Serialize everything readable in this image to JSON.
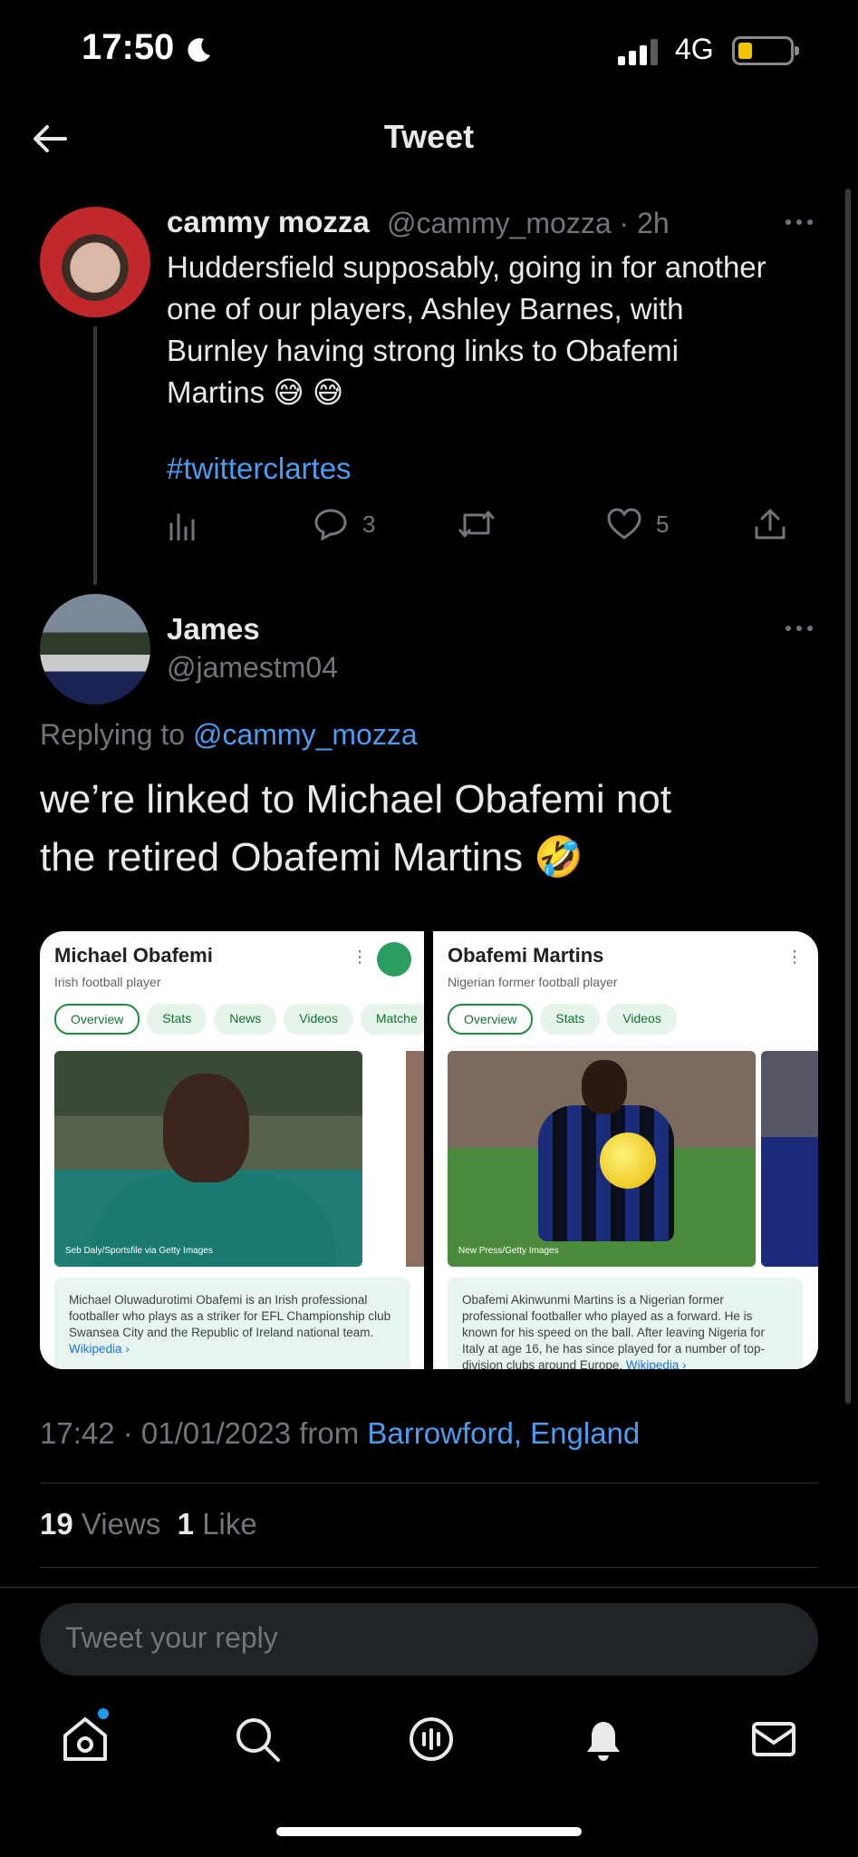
{
  "status_bar": {
    "time": "17:50",
    "network": "4G",
    "battery_level": 0.2,
    "icons": [
      "moon-icon",
      "signal-icon",
      "battery-icon"
    ]
  },
  "header": {
    "title": "Tweet",
    "back_icon": "arrow-left-icon"
  },
  "tweet": {
    "author_name": "cammy mozza",
    "author_handle_time": "@cammy_mozza · 2h",
    "text_lines": [
      "Huddersfield supposably, going in for another",
      "one of our players, Ashley Barnes, with",
      "Burnley having strong links to Obafemi",
      "Martins 😅 😅"
    ],
    "hashtag": "#twitterclartes",
    "actions": {
      "replies": "3",
      "likes": "5"
    }
  },
  "reply": {
    "author_name": "James",
    "author_handle": "@jamestm04",
    "replying_prefix": "Replying to",
    "replying_to": "@cammy_mozza",
    "text_lines": [
      "we’re linked to Michael Obafemi not",
      "the retired Obafemi Martins 🤣"
    ],
    "images": [
      {
        "title": "Michael Obafemi",
        "subtitle": "Irish football player",
        "chips": [
          "Overview",
          "Stats",
          "News",
          "Videos",
          "Matche"
        ],
        "credit": "Seb Daly/Sportsfile via Getty Images",
        "description": "Michael Oluwadurotimi Obafemi is an Irish professional footballer who plays as a striker for EFL Championship club Swansea City and the Republic of Ireland national team.",
        "wiki": "Wikipedia ›"
      },
      {
        "title": "Obafemi Martins",
        "subtitle": "Nigerian former football player",
        "chips": [
          "Overview",
          "Stats",
          "Videos"
        ],
        "credit": "New Press/Getty Images",
        "description": "Obafemi Akinwunmi Martins is a Nigerian former professional footballer who played as a forward. He is known for his speed on the ball. After leaving Nigeria for Italy at age 16, he has since played for a number of top-division clubs around Europe.",
        "wiki": "Wikipedia ›"
      }
    ],
    "timestamp": "17:42 · 01/01/2023 from",
    "location": "Barrowford, England",
    "views_count": "19",
    "views_label": "Views",
    "likes_count": "1",
    "likes_label": "Like"
  },
  "composer": {
    "placeholder": "Tweet your reply"
  },
  "tab_bar": {
    "tabs": [
      "home-icon",
      "search-icon",
      "spaces-icon",
      "notifications-icon",
      "messages-icon"
    ],
    "accent": "#1d9bf0"
  },
  "colors": {
    "link": "#4a9df0",
    "secondary_text": "#71767b",
    "background": "#000000"
  }
}
